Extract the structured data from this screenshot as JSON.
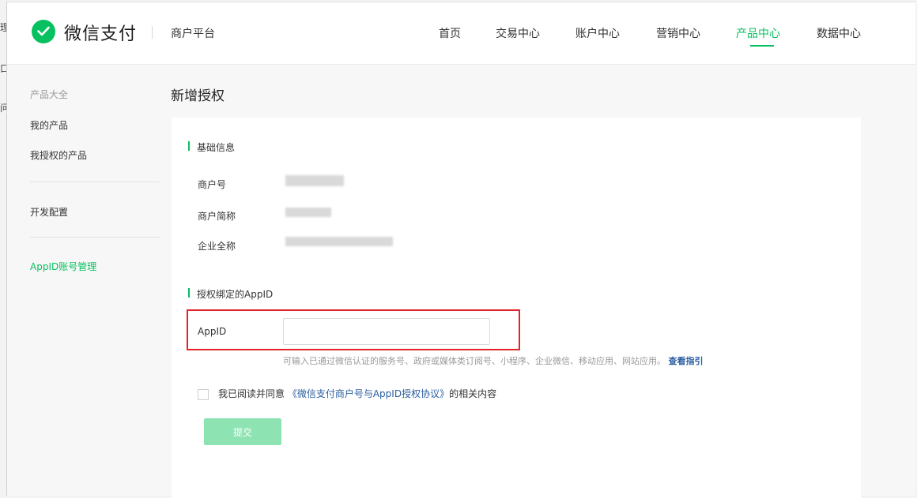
{
  "edge_fragments": [
    "理",
    "口",
    "问"
  ],
  "header": {
    "brand": "微信支付",
    "subtitle": "商户平台",
    "nav": [
      {
        "label": "首页",
        "active": false
      },
      {
        "label": "交易中心",
        "active": false
      },
      {
        "label": "账户中心",
        "active": false
      },
      {
        "label": "营销中心",
        "active": false
      },
      {
        "label": "产品中心",
        "active": true
      },
      {
        "label": "数据中心",
        "active": false
      }
    ]
  },
  "sidebar": {
    "group_title": "产品大全",
    "items": [
      {
        "label": "我的产品"
      },
      {
        "label": "我授权的产品"
      },
      {
        "label": "开发配置"
      },
      {
        "label": "AppID账号管理",
        "active": true
      }
    ]
  },
  "page": {
    "title": "新增授权",
    "basic": {
      "section_title": "基础信息",
      "fields": [
        {
          "label": "商户号"
        },
        {
          "label": "商户简称"
        },
        {
          "label": "企业全称"
        }
      ]
    },
    "appid": {
      "section_title": "授权绑定的AppID",
      "label": "AppID",
      "value": "",
      "placeholder": "",
      "hint": "可输入已通过微信认证的服务号、政府或媒体类订阅号、小程序、企业微信、移动应用、网站应用。",
      "hint_link": "查看指引"
    },
    "agree": {
      "prefix": "我已阅读并同意",
      "link": "《微信支付商户号与AppID授权协议》",
      "suffix": "的相关内容",
      "checked": false
    },
    "submit_label": "提交"
  },
  "colors": {
    "accent": "#07c160",
    "highlight_box": "#e2232a",
    "link": "#2a5d9f",
    "submit_disabled": "#8ee3b3"
  }
}
